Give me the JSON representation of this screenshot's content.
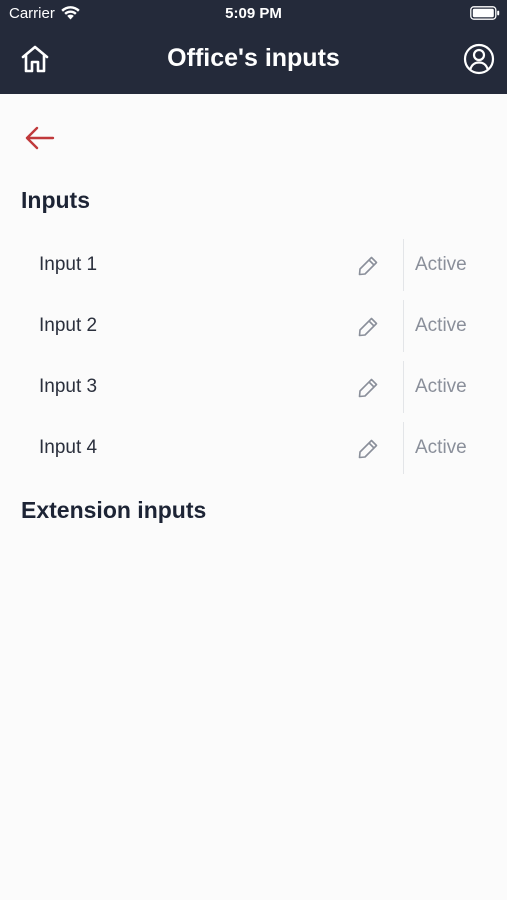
{
  "status_bar": {
    "carrier": "Carrier",
    "time": "5:09 PM"
  },
  "header": {
    "title": "Office's inputs",
    "home_icon": "home-icon",
    "profile_icon": "user-circle-icon",
    "background": "#242a3a"
  },
  "navigation": {
    "back_icon": "arrow-left-icon",
    "back_color": "#c0393b"
  },
  "sections": {
    "inputs_title": "Inputs",
    "extension_title": "Extension inputs"
  },
  "inputs": [
    {
      "label": "Input 1",
      "status": "Active",
      "edit_icon": "pencil-icon"
    },
    {
      "label": "Input 2",
      "status": "Active",
      "edit_icon": "pencil-icon"
    },
    {
      "label": "Input 3",
      "status": "Active",
      "edit_icon": "pencil-icon"
    },
    {
      "label": "Input 4",
      "status": "Active",
      "edit_icon": "pencil-icon"
    }
  ]
}
